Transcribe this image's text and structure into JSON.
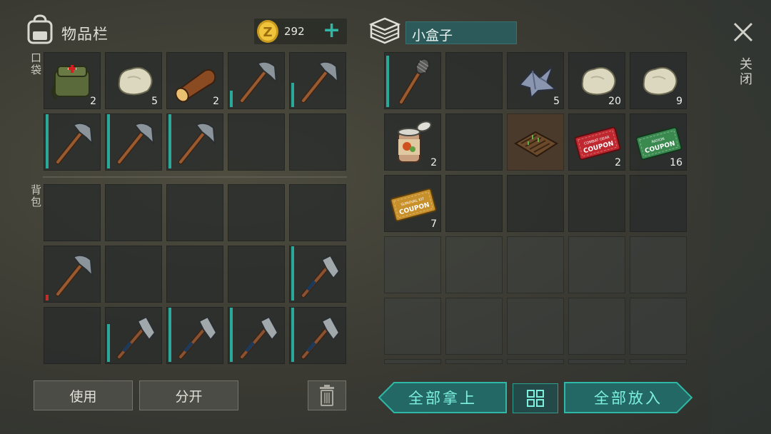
{
  "inventory": {
    "title": "物品栏",
    "coins": "292",
    "plus": "+",
    "pocket_label": "口袋",
    "backpack_label": "背包",
    "pocket": [
      {
        "item": "medkit-bag",
        "count": "2"
      },
      {
        "item": "stone",
        "count": "5"
      },
      {
        "item": "log",
        "count": "2"
      },
      {
        "item": "pickaxe",
        "durability": 0.3
      },
      {
        "item": "pickaxe",
        "durability": 0.45
      },
      {
        "item": "pickaxe",
        "durability": 1.0
      },
      {
        "item": "pickaxe",
        "durability": 1.0
      },
      {
        "item": "pickaxe",
        "durability": 1.0
      },
      {
        "item": "empty"
      },
      {
        "item": "empty"
      }
    ],
    "backpack": [
      {
        "item": "empty"
      },
      {
        "item": "empty"
      },
      {
        "item": "empty"
      },
      {
        "item": "empty"
      },
      {
        "item": "empty"
      },
      {
        "item": "pickaxe",
        "durability": 0.1,
        "low": true
      },
      {
        "item": "empty"
      },
      {
        "item": "empty"
      },
      {
        "item": "empty"
      },
      {
        "item": "hatchet",
        "durability": 1.0
      },
      {
        "item": "empty"
      },
      {
        "item": "hatchet",
        "durability": 0.7
      },
      {
        "item": "hatchet",
        "durability": 1.0
      },
      {
        "item": "hatchet",
        "durability": 1.0
      },
      {
        "item": "hatchet",
        "durability": 1.0
      }
    ]
  },
  "container": {
    "name": "小盒子",
    "slots": [
      {
        "item": "torch",
        "durability": 0.95
      },
      {
        "item": "empty"
      },
      {
        "item": "scrap-metal",
        "count": "5"
      },
      {
        "item": "stone",
        "count": "20"
      },
      {
        "item": "stone",
        "count": "9"
      },
      {
        "item": "canned-food",
        "count": "2"
      },
      {
        "item": "empty"
      },
      {
        "item": "garden-bed",
        "highlight": true
      },
      {
        "item": "coupon-red",
        "count": "2",
        "text": "COMBAT GEAR COUPON"
      },
      {
        "item": "coupon-green",
        "count": "16",
        "text": "RATION COUPON"
      },
      {
        "item": "coupon-gold",
        "count": "7",
        "text": "SURVIVAL KIT COUPON"
      },
      {
        "item": "empty"
      },
      {
        "item": "empty"
      },
      {
        "item": "empty"
      },
      {
        "item": "empty"
      }
    ],
    "locked_rows": 3
  },
  "actions": {
    "use": "使用",
    "split": "分开",
    "take_all": "全部拿上",
    "put_all": "全部放入",
    "close": "关闭"
  },
  "colors": {
    "accent": "#2fb8a6",
    "panel": "#2c5a5a"
  }
}
